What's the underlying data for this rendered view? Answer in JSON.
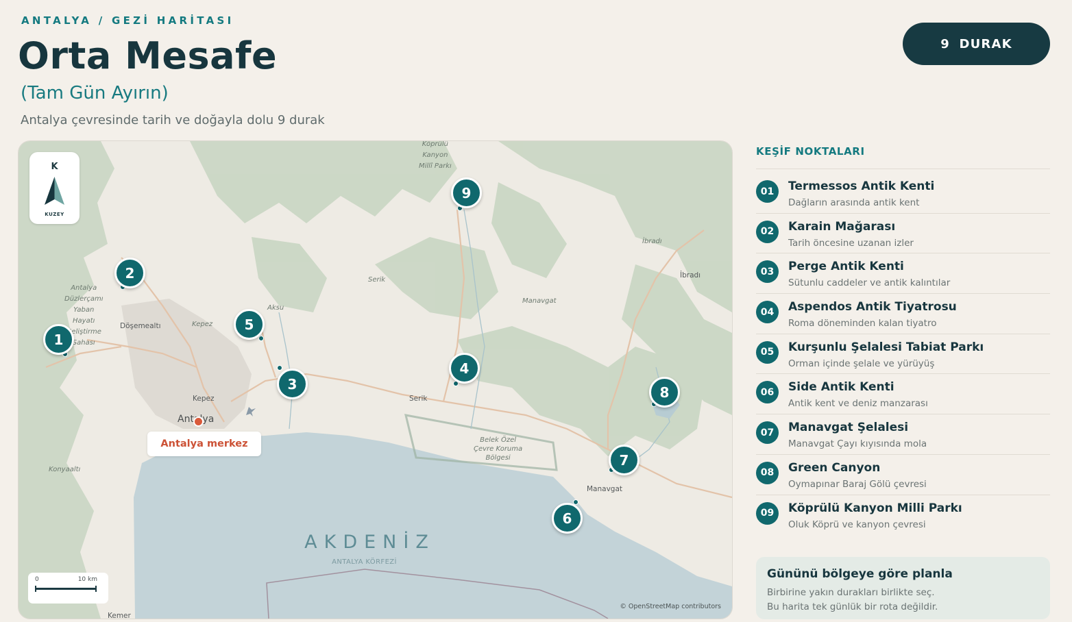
{
  "header": {
    "eyebrow": "ANTALYA / GEZİ HARİTASI",
    "title": "Orta Mesafe",
    "subtitle": "(Tam Gün Ayırın)",
    "description": "Antalya çevresinde tarih ve doğayla dolu 9 durak",
    "count_badge": "9 DURAK"
  },
  "map": {
    "compass_letter": "K",
    "compass_caption": "KUZEY",
    "scale_start": "0",
    "scale_end": "10 km",
    "attribution": "© OpenStreetMap contributors",
    "sea_label": "AKDENİZ",
    "gulf_label": "ANTALYA KÖRFEZİ",
    "center_label": "Antalya merkez",
    "places": {
      "koprulu": "Köprülü Kanyon Millî Parkı",
      "antalya_park": "Antalya Düzlerçamı Yaban Hayatı Geliştirme Sahası",
      "serik_area": "Serik",
      "manavgat_area": "Manavgat",
      "ibradi_area": "İbradı",
      "aksu_area": "Aksu",
      "kepez_area": "Kepez",
      "belek": "Belek Özel Çevre Koruma Bölgesi",
      "konyaalti": "Konyaaltı"
    },
    "towns": {
      "dosemealti": "Döşemealtı",
      "kepez": "Kepez",
      "antalya": "Antalya",
      "serik": "Serik",
      "manavgat": "Manavgat",
      "ibradi": "İbradı",
      "kemer": "Kemer"
    },
    "accent": "#10686d",
    "center_color": "#d95a3b"
  },
  "markers": [
    "1",
    "2",
    "3",
    "4",
    "5",
    "6",
    "7",
    "8",
    "9"
  ],
  "sidebar": {
    "heading": "KEŞİF NOKTALARI",
    "stops": [
      {
        "num": "01",
        "name": "Termessos Antik Kenti",
        "desc": "Dağların arasında antik kent"
      },
      {
        "num": "02",
        "name": "Karain Mağarası",
        "desc": "Tarih öncesine uzanan izler"
      },
      {
        "num": "03",
        "name": "Perge Antik Kenti",
        "desc": "Sütunlu caddeler ve antik kalıntılar"
      },
      {
        "num": "04",
        "name": "Aspendos Antik Tiyatrosu",
        "desc": "Roma döneminden kalan tiyatro"
      },
      {
        "num": "05",
        "name": "Kurşunlu Şelalesi Tabiat Parkı",
        "desc": "Orman içinde şelale ve yürüyüş"
      },
      {
        "num": "06",
        "name": "Side Antik Kenti",
        "desc": "Antik kent ve deniz manzarası"
      },
      {
        "num": "07",
        "name": "Manavgat Şelalesi",
        "desc": "Manavgat Çayı kıyısında mola"
      },
      {
        "num": "08",
        "name": "Green Canyon",
        "desc": "Oymapınar Baraj Gölü çevresi"
      },
      {
        "num": "09",
        "name": "Köprülü Kanyon Milli Parkı",
        "desc": "Oluk Köprü ve kanyon çevresi"
      }
    ]
  },
  "tip": {
    "title": "Gününü bölgeye göre planla",
    "line1": "Birbirine yakın durakları birlikte seç.",
    "line2": "Bu harita tek günlük bir rota değildir."
  }
}
